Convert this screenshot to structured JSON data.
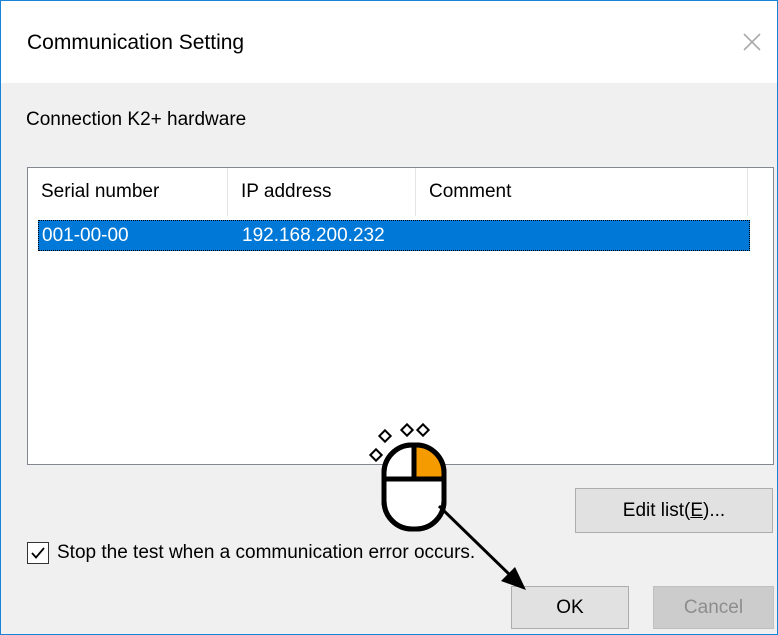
{
  "window": {
    "title": "Communication Setting",
    "close_glyph": "✕"
  },
  "group": {
    "label": "Connection K2+ hardware"
  },
  "list": {
    "columns": [
      "Serial number",
      "IP address",
      "Comment"
    ],
    "rows": [
      {
        "serial": "001-00-00",
        "ip": "192.168.200.232",
        "comment": "",
        "selected": true
      }
    ],
    "selection_color": "#0078d7"
  },
  "buttons": {
    "edit_prefix": "Edit list(",
    "edit_mnemonic": "E",
    "edit_suffix": ")...",
    "ok": "OK",
    "cancel": "Cancel"
  },
  "checkbox": {
    "label": "Stop the test when a communication error occurs.",
    "checked": true
  },
  "annotation": {
    "icon": "mouse-click-icon",
    "accent": "#f59b00",
    "arrow_target": "OK button"
  }
}
